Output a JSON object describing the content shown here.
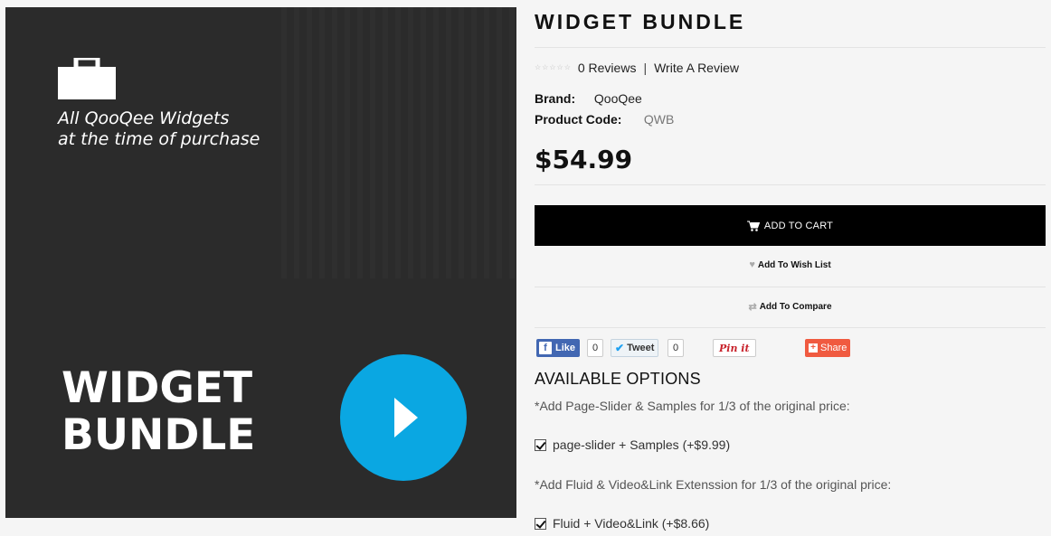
{
  "image": {
    "tagline_line1": "All QooQee Widgets",
    "tagline_line2": "at the time of purchase",
    "title_line1": "WIDGET",
    "title_line2": "BUNDLE",
    "accent_color": "#0aa7e2"
  },
  "product": {
    "title": "WIDGET BUNDLE",
    "rating": {
      "stars": 0,
      "max": 5
    },
    "reviews": "0 Reviews",
    "review_separator": "|",
    "write_review": "Write A Review",
    "brand_label": "Brand:",
    "brand_value": "QooQee",
    "code_label": "Product Code:",
    "code_value": "QWB",
    "price": "$54.99"
  },
  "actions": {
    "add_to_cart": "ADD TO CART",
    "wish_list": "Add To Wish List",
    "compare": "Add To Compare"
  },
  "social": {
    "like": "Like",
    "like_count": "0",
    "tweet": "Tweet",
    "tweet_count": "0",
    "pin": "Pin it",
    "share": "Share"
  },
  "options": {
    "title": "AVAILABLE OPTIONS",
    "note1": "*Add Page-Slider & Samples for 1/3 of the original price:",
    "option1": "page-slider + Samples (+$9.99)",
    "note2": "*Add Fluid & Video&Link Extenssion for 1/3 of the original price:",
    "option2": "Fluid + Video&Link (+$8.66)"
  }
}
